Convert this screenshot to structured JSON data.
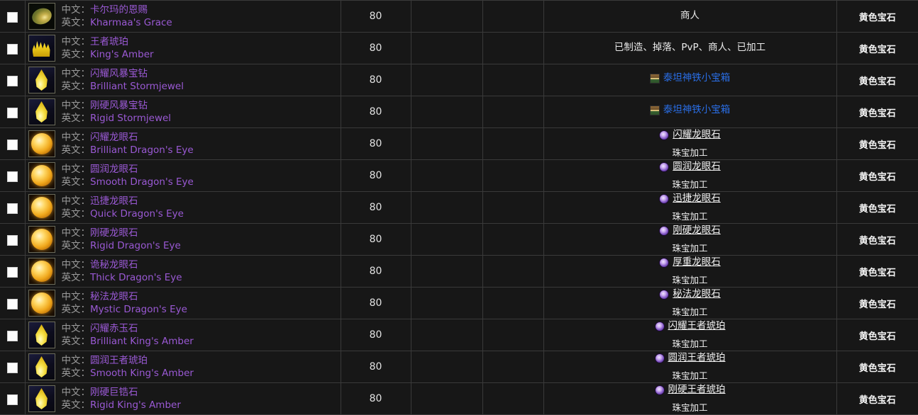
{
  "table": {
    "columns": [
      {
        "key": "checkbox",
        "label": ""
      },
      {
        "key": "item",
        "label": ""
      },
      {
        "key": "level",
        "label": ""
      },
      {
        "key": "col_a",
        "label": ""
      },
      {
        "key": "col_b",
        "label": ""
      },
      {
        "key": "source",
        "label": ""
      },
      {
        "key": "type",
        "label": ""
      }
    ],
    "labels": {
      "chinese": "中文：",
      "english": "英文："
    },
    "rows": [
      {
        "icon": "gem-olive-oval-icon",
        "icon_style": "ic-olive",
        "name_cn": "卡尔玛的恩赐",
        "name_en": "Kharmaa's Grace",
        "level": "80",
        "col_a": "",
        "col_b": "",
        "source_kind": "plain",
        "source_text": "商人",
        "source_sub": "",
        "source_icon": "",
        "type": "黄色宝石"
      },
      {
        "icon": "gem-cluster-icon",
        "icon_style": "ic-cluster",
        "name_cn": "王者琥珀",
        "name_en": "King's Amber",
        "level": "80",
        "col_a": "",
        "col_b": "",
        "source_kind": "plain",
        "source_text": "已制造、掉落、PvP、商人、已加工",
        "source_sub": "",
        "source_icon": "",
        "type": "黄色宝石"
      },
      {
        "icon": "gem-teardrop-icon",
        "icon_style": "ic-drop",
        "name_cn": "闪耀风暴宝钻",
        "name_en": "Brilliant Stormjewel",
        "level": "80",
        "col_a": "",
        "col_b": "",
        "source_kind": "link",
        "source_text": "泰坦神铁小宝箱",
        "source_sub": "",
        "source_icon": "chest-icon",
        "type": "黄色宝石"
      },
      {
        "icon": "gem-teardrop-icon",
        "icon_style": "ic-drop",
        "name_cn": "刚硬风暴宝钻",
        "name_en": "Rigid Stormjewel",
        "level": "80",
        "col_a": "",
        "col_b": "",
        "source_kind": "link",
        "source_text": "泰坦神铁小宝箱",
        "source_sub": "",
        "source_icon": "chest-icon",
        "type": "黄色宝石"
      },
      {
        "icon": "gem-round-icon",
        "icon_style": "ic-round",
        "name_cn": "闪耀龙眼石",
        "name_en": "Brilliant Dragon's Eye",
        "level": "80",
        "col_a": "",
        "col_b": "",
        "source_kind": "craft",
        "source_text": "闪耀龙眼石",
        "source_sub": "珠宝加工",
        "source_icon": "purple-gem-icon",
        "type": "黄色宝石"
      },
      {
        "icon": "gem-round-icon",
        "icon_style": "ic-round",
        "name_cn": "圆润龙眼石",
        "name_en": "Smooth Dragon's Eye",
        "level": "80",
        "col_a": "",
        "col_b": "",
        "source_kind": "craft",
        "source_text": "圆润龙眼石",
        "source_sub": "珠宝加工",
        "source_icon": "purple-gem-icon",
        "type": "黄色宝石"
      },
      {
        "icon": "gem-round-icon",
        "icon_style": "ic-round",
        "name_cn": "迅捷龙眼石",
        "name_en": "Quick Dragon's Eye",
        "level": "80",
        "col_a": "",
        "col_b": "",
        "source_kind": "craft",
        "source_text": "迅捷龙眼石",
        "source_sub": "珠宝加工",
        "source_icon": "purple-gem-icon",
        "type": "黄色宝石"
      },
      {
        "icon": "gem-round-icon",
        "icon_style": "ic-round",
        "name_cn": "刚硬龙眼石",
        "name_en": "Rigid Dragon's Eye",
        "level": "80",
        "col_a": "",
        "col_b": "",
        "source_kind": "craft",
        "source_text": "刚硬龙眼石",
        "source_sub": "珠宝加工",
        "source_icon": "purple-gem-icon",
        "type": "黄色宝石"
      },
      {
        "icon": "gem-round-icon",
        "icon_style": "ic-round",
        "name_cn": "诡秘龙眼石",
        "name_en": "Thick Dragon's Eye",
        "level": "80",
        "col_a": "",
        "col_b": "",
        "source_kind": "craft",
        "source_text": "厚重龙眼石",
        "source_sub": "珠宝加工",
        "source_icon": "purple-gem-icon",
        "type": "黄色宝石"
      },
      {
        "icon": "gem-round-icon",
        "icon_style": "ic-round",
        "name_cn": "秘法龙眼石",
        "name_en": "Mystic Dragon's Eye",
        "level": "80",
        "col_a": "",
        "col_b": "",
        "source_kind": "craft",
        "source_text": "秘法龙眼石",
        "source_sub": "珠宝加工",
        "source_icon": "purple-gem-icon",
        "type": "黄色宝石"
      },
      {
        "icon": "gem-teardrop-icon",
        "icon_style": "ic-drop",
        "name_cn": "闪耀赤玉石",
        "name_en": "Brilliant King's Amber",
        "level": "80",
        "col_a": "",
        "col_b": "",
        "source_kind": "craft",
        "source_text": "闪耀王者琥珀",
        "source_sub": "珠宝加工",
        "source_icon": "purple-gem-icon",
        "type": "黄色宝石"
      },
      {
        "icon": "gem-teardrop-icon",
        "icon_style": "ic-drop",
        "name_cn": "圆润王者琥珀",
        "name_en": "Smooth King's Amber",
        "level": "80",
        "col_a": "",
        "col_b": "",
        "source_kind": "craft",
        "source_text": "圆润王者琥珀",
        "source_sub": "珠宝加工",
        "source_icon": "purple-gem-icon",
        "type": "黄色宝石"
      },
      {
        "icon": "gem-teardrop-icon",
        "icon_style": "ic-drop",
        "name_cn": "刚硬巨锆石",
        "name_en": "Rigid King's Amber",
        "level": "80",
        "col_a": "",
        "col_b": "",
        "source_kind": "craft",
        "source_text": "刚硬王者琥珀",
        "source_sub": "珠宝加工",
        "source_icon": "purple-gem-icon",
        "type": "黄色宝石"
      }
    ]
  },
  "colors": {
    "background": "#161616",
    "row_bg": "#171717",
    "border": "#3a3a3a",
    "epic_name": "#9a59d4",
    "label_gray": "#9b9b9b",
    "link_blue": "#2a6fe8",
    "text_white": "#f2f2f2"
  }
}
